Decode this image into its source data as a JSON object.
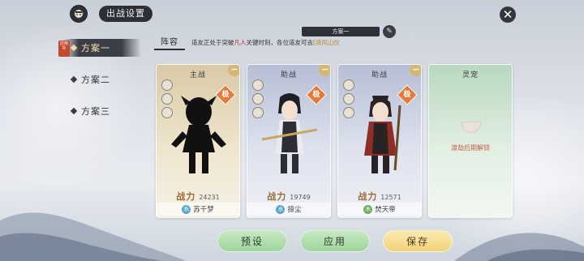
{
  "header": {
    "title": "出战设置"
  },
  "scheme_menu": {
    "items": [
      {
        "label": "方案一",
        "active": true
      },
      {
        "label": "方案二",
        "active": false
      },
      {
        "label": "方案三",
        "active": false
      }
    ],
    "in_use_tag": "应用中"
  },
  "lineup": {
    "tab_label": "阵容",
    "scheme_name": "方案一",
    "tip": {
      "part1": "道友正处于突破",
      "highlight1": "凡人",
      "part2": "关键时刻，各位道友可去",
      "highlight2": "[清风山仪"
    }
  },
  "cards": [
    {
      "role": "主战",
      "rank": "极",
      "power_label": "战力",
      "power_value": "24231",
      "element": "水",
      "name": "苏千梦"
    },
    {
      "role": "助战",
      "rank": "极",
      "power_label": "战力",
      "power_value": "19749",
      "element": "水",
      "name": "掠尘"
    },
    {
      "role": "助战",
      "rank": "极",
      "power_label": "战力",
      "power_value": "12571",
      "element": "木",
      "name": "焚天帝"
    }
  ],
  "pet_card": {
    "role": "灵宠",
    "lock_text": "渡劫后期解锁"
  },
  "buttons": {
    "preset": "预设",
    "apply": "应用",
    "save": "保存"
  },
  "colors": {
    "active_scheme_bg": "#3b3e46",
    "power_label": "#9b6a34",
    "rank_badge": "#e57a3a",
    "green_button": "#9fd49c",
    "gold_button": "#f1d27a"
  }
}
